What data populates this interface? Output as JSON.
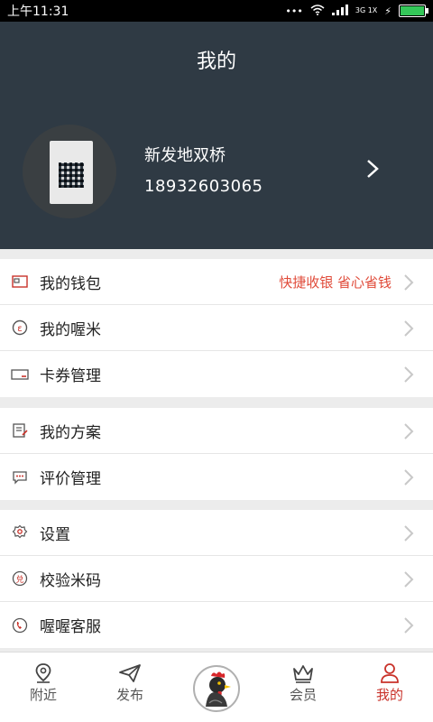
{
  "status_bar": {
    "time": "上午11:31",
    "network": "3G 1X"
  },
  "header": {
    "title": "我的"
  },
  "profile": {
    "name": "新发地双桥",
    "phone": "18932603065"
  },
  "menu_groups": [
    {
      "items": [
        {
          "label": "我的钱包",
          "extra": "快捷收银  省心省钱"
        },
        {
          "label": "我的喔米"
        },
        {
          "label": "卡券管理"
        }
      ]
    },
    {
      "items": [
        {
          "label": "我的方案"
        },
        {
          "label": "评价管理"
        }
      ]
    },
    {
      "items": [
        {
          "label": "设置"
        },
        {
          "label": "校验米码"
        },
        {
          "label": "喔喔客服"
        }
      ]
    }
  ],
  "bottom_nav": {
    "nearby": "附近",
    "publish": "发布",
    "member": "会员",
    "mine": "我的"
  },
  "colors": {
    "accent": "#c9322a",
    "header_bg": "#2f3a44",
    "extra_text": "#e04b3a"
  }
}
